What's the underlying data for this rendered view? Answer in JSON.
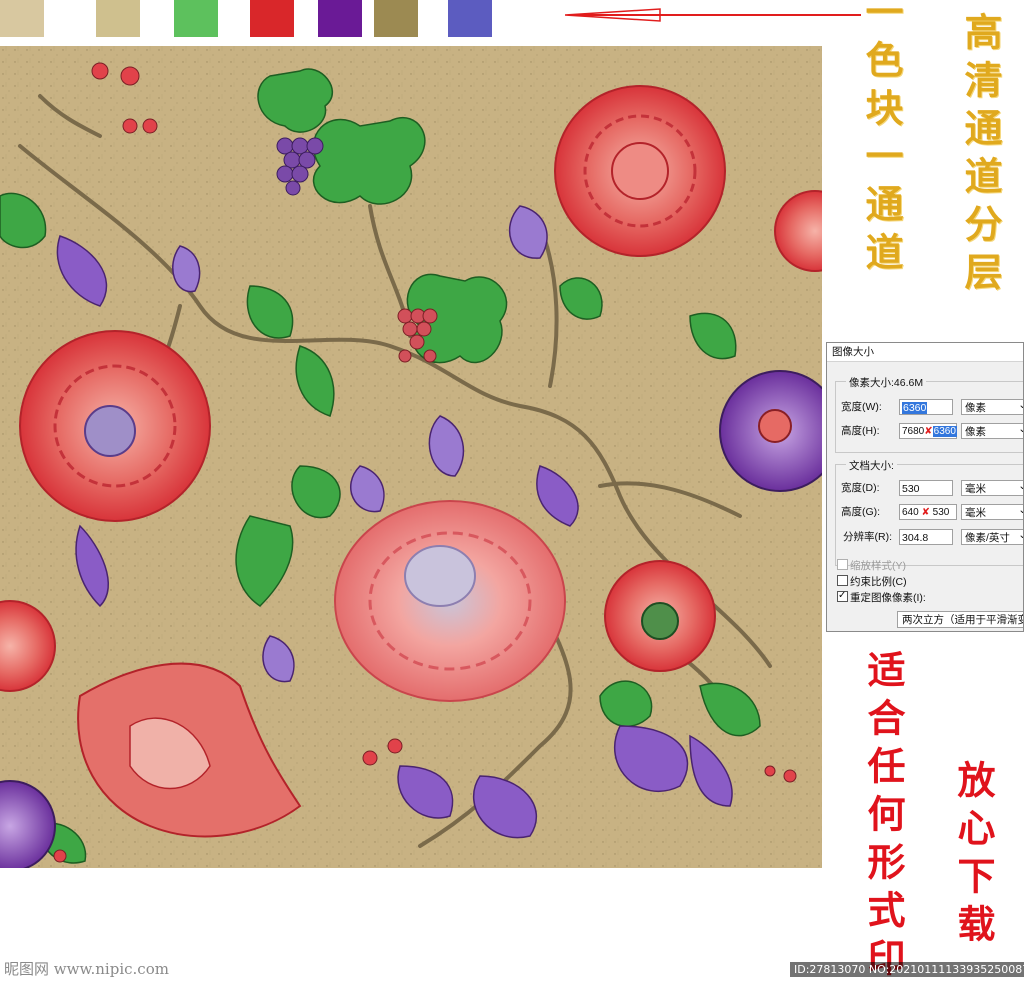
{
  "swatches": [
    {
      "name": "beige",
      "color": "#d8c8a0"
    },
    {
      "name": "white",
      "color": "#ffffff"
    },
    {
      "name": "khaki",
      "color": "#cfc08e"
    },
    {
      "name": "green",
      "color": "#5dc15d"
    },
    {
      "name": "red",
      "color": "#d9272a"
    },
    {
      "name": "purple",
      "color": "#6a1a96"
    },
    {
      "name": "olive",
      "color": "#9c8a52"
    },
    {
      "name": "blue-violet",
      "color": "#5c5cc0"
    }
  ],
  "captions": {
    "one_color_one_channel": "一色块一通道",
    "hd_channel_layers": "高清通道分层",
    "suitable_any_print": "适合任何形式印",
    "download_safe": "放心下载"
  },
  "dialog": {
    "title": "图像大小",
    "pixel_group_label": "像素大小:46.6M",
    "width_label": "宽度(W):",
    "width_value": "6360",
    "width_unit": "像素",
    "height_label": "高度(H):",
    "height_value_old": "7680",
    "height_value_new": "6360",
    "height_unit": "像素",
    "doc_group_label": "文档大小:",
    "doc_width_label": "宽度(D):",
    "doc_width_value": "530",
    "doc_width_unit": "毫米",
    "doc_height_label": "高度(G):",
    "doc_height_value_old": "640",
    "doc_height_value_new": "530",
    "doc_height_unit": "毫米",
    "resolution_label": "分辨率(R):",
    "resolution_value": "304.8",
    "resolution_unit": "像素/英寸",
    "scale_styles": "缩放样式(Y)",
    "constrain": "约束比例(C)",
    "resample": "重定图像像素(I):",
    "resample_method": "两次立方（适用于平滑渐变"
  },
  "watermark": {
    "logo": "昵图网 www.nipic.com",
    "id": "ID:27813070 NO:20210111133935250087"
  },
  "colors": {
    "background_fabric": "#c8b283",
    "arrow": "#e11d1d"
  }
}
